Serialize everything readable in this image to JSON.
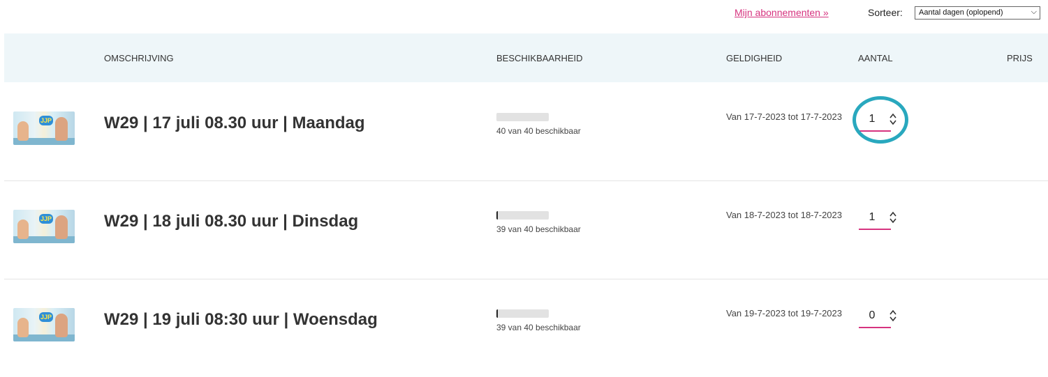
{
  "toolbar": {
    "subscriptions_link": "Mijn abonnementen »",
    "sort_label": "Sorteer:",
    "sort_value": "Aantal dagen (oplopend)"
  },
  "table": {
    "headers": {
      "description": "OMSCHRIJVING",
      "availability": "BESCHIKBAARHEID",
      "validity": "GELDIGHEID",
      "quantity": "AANTAL",
      "price": "PRIJS"
    },
    "rows": [
      {
        "title": "W29 | 17 juli 08.30 uur | Maandag",
        "availability": "40 van 40 beschikbaar",
        "used_fraction": 0.0,
        "validity": "Van 17-7-2023 tot 17-7-2023",
        "quantity": "1",
        "thumb_logo": "JJP"
      },
      {
        "title": "W29 | 18 juli 08.30 uur | Dinsdag",
        "availability": "39 van 40 beschikbaar",
        "used_fraction": 0.025,
        "validity": "Van 18-7-2023 tot 18-7-2023",
        "quantity": "1",
        "thumb_logo": "JJP"
      },
      {
        "title": "W29 | 19 juli 08:30 uur | Woensdag",
        "availability": "39 van 40 beschikbaar",
        "used_fraction": 0.025,
        "validity": "Van 19-7-2023 tot 19-7-2023",
        "quantity": "0",
        "thumb_logo": "JJP"
      }
    ]
  },
  "colors": {
    "accent": "#d6337f",
    "header_bg": "#eef6f9",
    "highlight": "#29a8be"
  },
  "icons": {
    "spinner": "up-down-chevron-icon",
    "select": "chevron-down-icon"
  }
}
